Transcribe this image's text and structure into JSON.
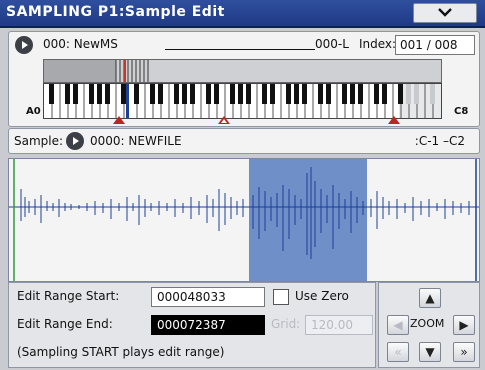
{
  "header": {
    "title": "SAMPLING P1:Sample Edit",
    "menu_icon": "chevron-down-icon"
  },
  "multisample": {
    "id": "000: NewMS",
    "suffix": "000-L",
    "index_label": "Index:",
    "index_value": "001 / 008",
    "range_low": "A0",
    "range_high": "C8"
  },
  "sample": {
    "label": "Sample:",
    "name": "0000: NEWFILE",
    "range": ":C-1 –C2"
  },
  "edit": {
    "start_label": "Edit Range Start:",
    "start_value": "000048033",
    "end_label": "Edit Range End:",
    "end_value": "000072387",
    "use_zero_label": "Use Zero",
    "grid_label": "Grid:",
    "grid_value": "120.00",
    "hint": "(Sampling START plays edit range)"
  },
  "zoom": {
    "label": "ZOOM"
  },
  "colors": {
    "title_bar": "#243f8c",
    "wave": "#1d3f97",
    "selection": "#6e8fc8",
    "marker": "#b8281c"
  }
}
